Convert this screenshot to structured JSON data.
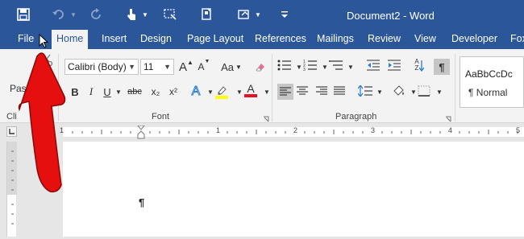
{
  "window": {
    "title": "Document2 - Word"
  },
  "quick_access": {
    "save_icon": "save-icon",
    "undo_icon": "undo-icon",
    "redo_icon": "redo-icon",
    "touch_mode_icon": "touch-mode-icon",
    "screenshot_icon": "screen-clipping-icon",
    "page_icon": "page-icon",
    "paint_icon": "paint-icon",
    "customize_icon": "customize-icon"
  },
  "tabs": [
    {
      "label": "File"
    },
    {
      "label": "Home"
    },
    {
      "label": "Insert"
    },
    {
      "label": "Design"
    },
    {
      "label": "Page Layout"
    },
    {
      "label": "References"
    },
    {
      "label": "Mailings"
    },
    {
      "label": "Review"
    },
    {
      "label": "View"
    },
    {
      "label": "Developer"
    },
    {
      "label": "Fox"
    }
  ],
  "clipboard": {
    "paste_label": "Pas",
    "group_label": "Cli"
  },
  "font": {
    "family": "Calibri (Body)",
    "size": "11",
    "grow": "A",
    "shrink": "A",
    "case": "Aa",
    "bold": "B",
    "italic": "I",
    "underline": "U",
    "strike": "abc",
    "subscript": "x₂",
    "superscript": "x²",
    "effects": "A",
    "highlight_color": "#ffff00",
    "font_color": "A",
    "font_color_value": "#e81123",
    "group_label": "Font"
  },
  "paragraph": {
    "group_label": "Paragraph",
    "sort": "A Z",
    "show_marks": "¶"
  },
  "styles": {
    "preview": "AaBbCcDc",
    "name": "¶ Normal"
  },
  "ruler": {
    "ticks": [
      "1",
      "1",
      "2",
      "3",
      "4",
      "5"
    ]
  },
  "document": {
    "paragraph_mark": "¶"
  },
  "accent": {
    "brand": "#2b579a",
    "arrow": "#e50f0f"
  }
}
